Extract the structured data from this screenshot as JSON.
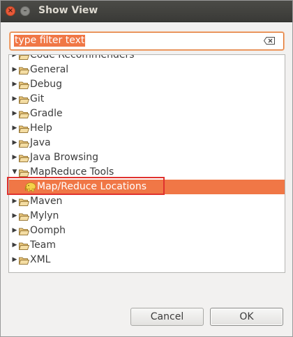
{
  "window": {
    "title": "Show View"
  },
  "filter": {
    "value": "type filter text"
  },
  "tree": {
    "items": [
      {
        "label": "Code Recommenders",
        "expanded": false
      },
      {
        "label": "General",
        "expanded": false
      },
      {
        "label": "Debug",
        "expanded": false
      },
      {
        "label": "Git",
        "expanded": false
      },
      {
        "label": "Gradle",
        "expanded": false
      },
      {
        "label": "Help",
        "expanded": false
      },
      {
        "label": "Java",
        "expanded": false
      },
      {
        "label": "Java Browsing",
        "expanded": false
      },
      {
        "label": "MapReduce Tools",
        "expanded": true,
        "children": [
          {
            "label": "Map/Reduce Locations",
            "selected": true,
            "icon": "elephant-icon"
          }
        ]
      },
      {
        "label": "Maven",
        "expanded": false
      },
      {
        "label": "Mylyn",
        "expanded": false
      },
      {
        "label": "Oomph",
        "expanded": false
      },
      {
        "label": "Team",
        "expanded": false
      },
      {
        "label": "XML",
        "expanded": false
      }
    ]
  },
  "buttons": {
    "cancel": "Cancel",
    "ok": "OK"
  },
  "colors": {
    "selection": "#f07746",
    "highlight_box": "#e0312e",
    "titlebar": "#3c3b37"
  }
}
